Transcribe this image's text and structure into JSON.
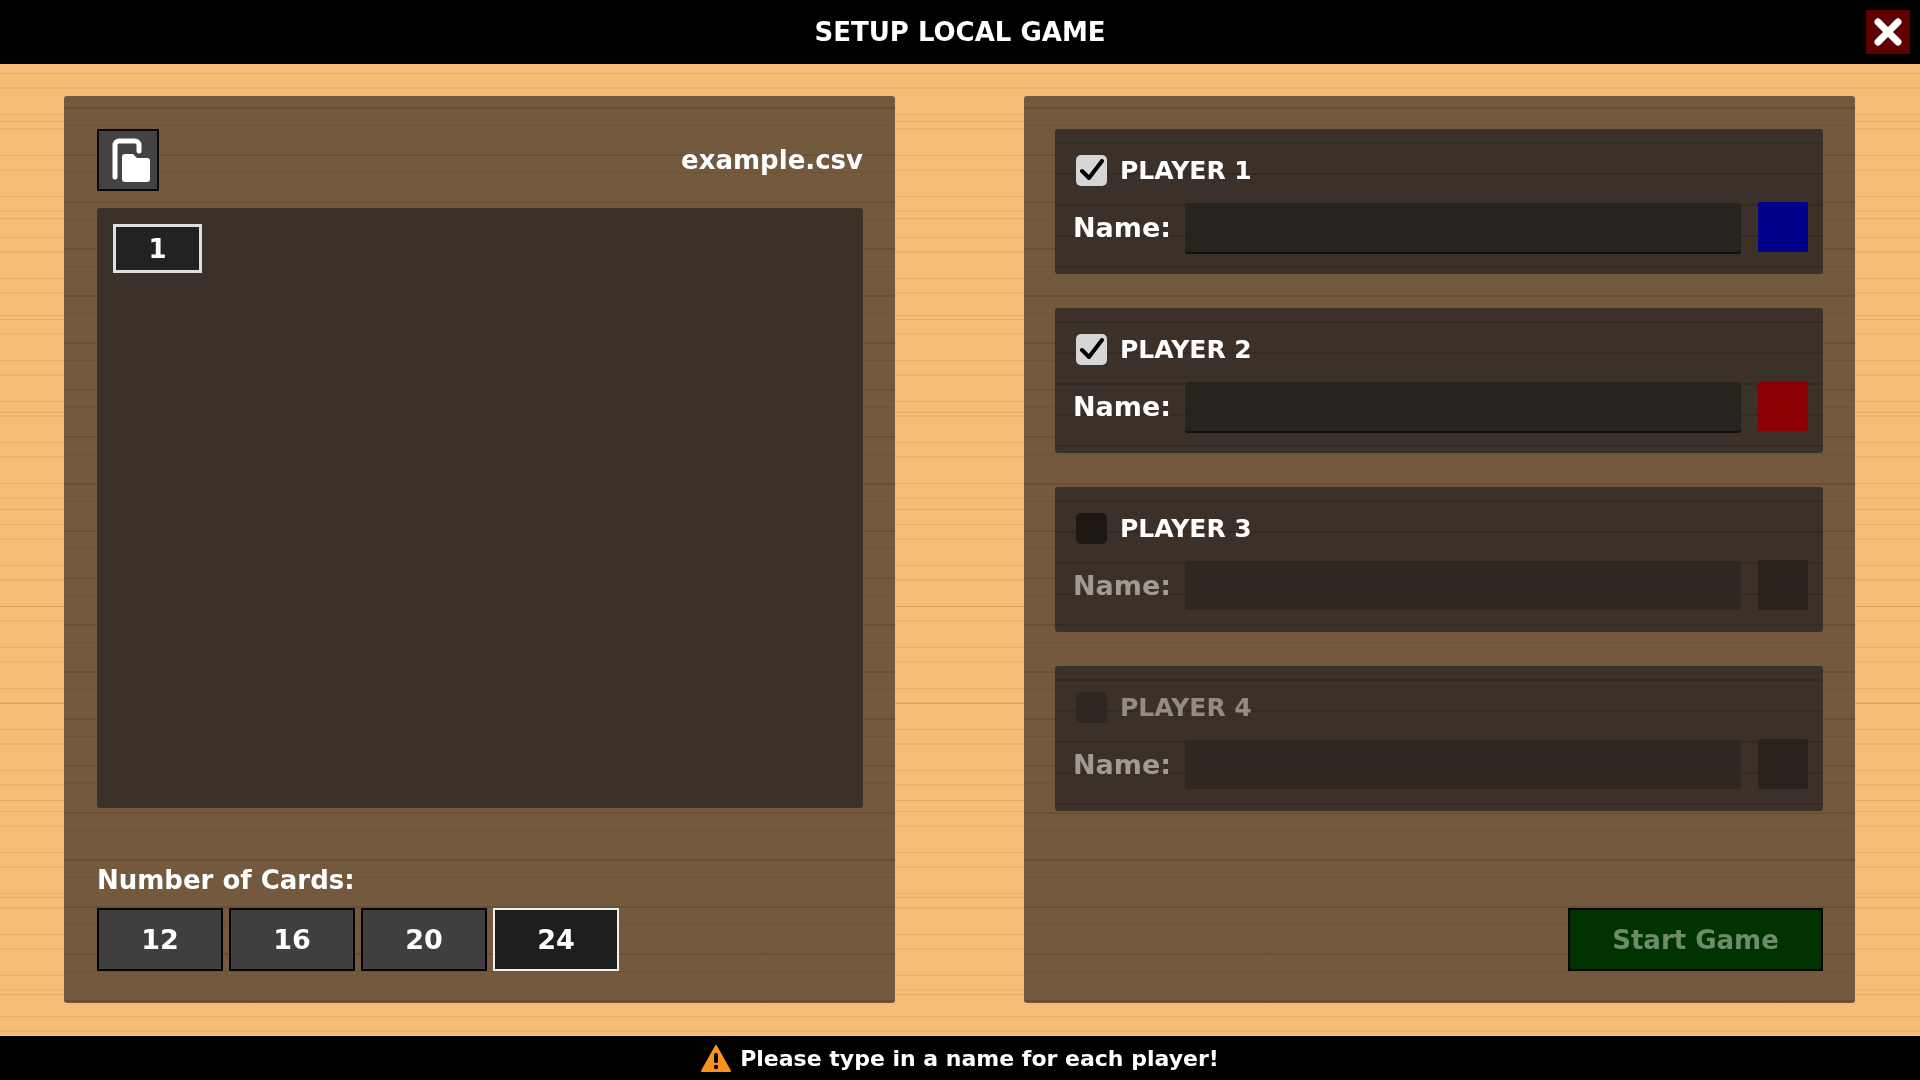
{
  "window": {
    "title": "SETUP LOCAL GAME"
  },
  "deck": {
    "file_name": "example.csv",
    "items": [
      {
        "label": "1"
      }
    ]
  },
  "card_count": {
    "label": "Number of Cards:",
    "options": [
      {
        "label": "12",
        "selected": false
      },
      {
        "label": "16",
        "selected": false
      },
      {
        "label": "20",
        "selected": false
      },
      {
        "label": "24",
        "selected": true
      }
    ]
  },
  "players": [
    {
      "label": "PLAYER 1",
      "checked": true,
      "disabled": false,
      "name_label": "Name:",
      "color": "#00008b"
    },
    {
      "label": "PLAYER 2",
      "checked": true,
      "disabled": false,
      "name_label": "Name:",
      "color": "#8b0000"
    },
    {
      "label": "PLAYER 3",
      "checked": false,
      "disabled": false,
      "name_label": "Name:"
    },
    {
      "label": "PLAYER 4",
      "checked": false,
      "disabled": true,
      "name_label": "Name:"
    }
  ],
  "start_button": {
    "label": "Start Game",
    "disabled": true
  },
  "status_bar": {
    "kind": "warning",
    "message": "Please type in a name for each player!"
  }
}
